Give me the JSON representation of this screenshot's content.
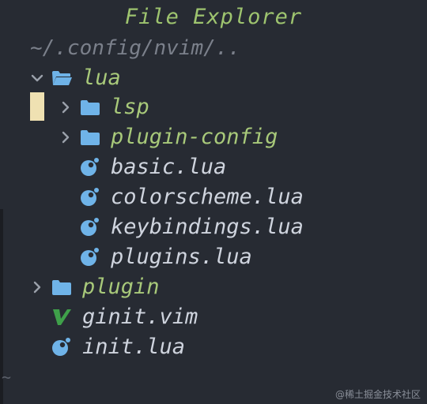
{
  "title": "File Explorer",
  "cwd": "~/.config/nvim/..",
  "tree": {
    "lua": {
      "label": "lua",
      "expanded": true,
      "icon": "folder-open-icon"
    },
    "lsp": {
      "label": "lsp",
      "expanded": false,
      "icon": "folder-icon"
    },
    "plugin_config": {
      "label": "plugin-config",
      "expanded": false,
      "icon": "folder-icon"
    },
    "basic": {
      "label": "basic.lua",
      "icon": "lua-icon"
    },
    "colorscheme": {
      "label": "colorscheme.lua",
      "icon": "lua-icon"
    },
    "keybindings": {
      "label": "keybindings.lua",
      "icon": "lua-icon"
    },
    "plugins": {
      "label": "plugins.lua",
      "icon": "lua-icon"
    },
    "plugin": {
      "label": "plugin",
      "expanded": false,
      "icon": "folder-icon"
    },
    "ginit": {
      "label": "ginit.vim",
      "icon": "vim-icon"
    },
    "init": {
      "label": "init.lua",
      "icon": "lua-icon"
    }
  },
  "empty_line_marker": "~",
  "watermark": "@稀土掘金技术社区",
  "colors": {
    "background": "#272b33",
    "title": "#9ec46f",
    "directory": "#a8c97a",
    "file": "#cfd4de",
    "folder_icon": "#6fb3e8",
    "vim_icon": "#3fa04a",
    "cursor": "#efe1b2"
  }
}
